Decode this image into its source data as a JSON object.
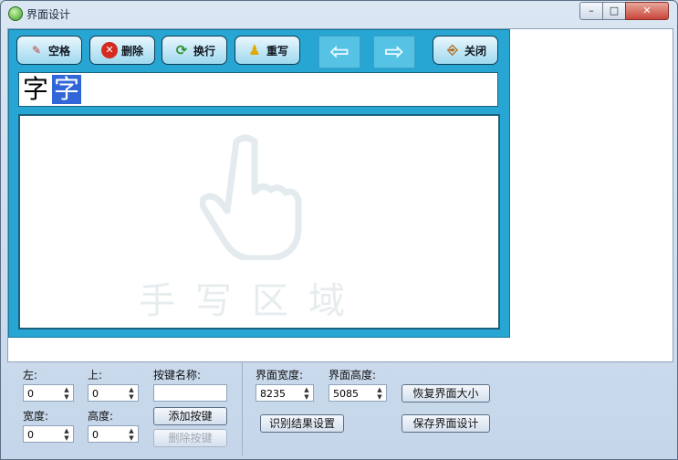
{
  "window": {
    "title": "界面设计",
    "controls": {
      "minimize": "–",
      "maximize": "□",
      "close": "✕"
    }
  },
  "toolbar": {
    "space": "空格",
    "delete": "删除",
    "newline": "换行",
    "rewrite": "重写",
    "prev_icon": "left-arrow-icon",
    "next_icon": "right-arrow-icon",
    "close": "关闭"
  },
  "candidates": [
    {
      "char": "字",
      "selected": false
    },
    {
      "char": "字",
      "selected": true
    }
  ],
  "write_area": {
    "watermark": "手写区域"
  },
  "key_settings": {
    "left_label": "左:",
    "left_value": "0",
    "top_label": "上:",
    "top_value": "0",
    "key_name_label": "按键名称:",
    "key_name_value": "",
    "width_label": "宽度:",
    "width_value": "0",
    "height_label": "高度:",
    "height_value": "0",
    "add_key": "添加按键",
    "delete_key": "删除按键"
  },
  "interface_settings": {
    "width_label": "界面宽度:",
    "width_value": "8235",
    "height_label": "界面高度:",
    "height_value": "5085",
    "restore_size": "恢复界面大小",
    "recognition_settings": "识别结果设置",
    "save_design": "保存界面设计"
  }
}
